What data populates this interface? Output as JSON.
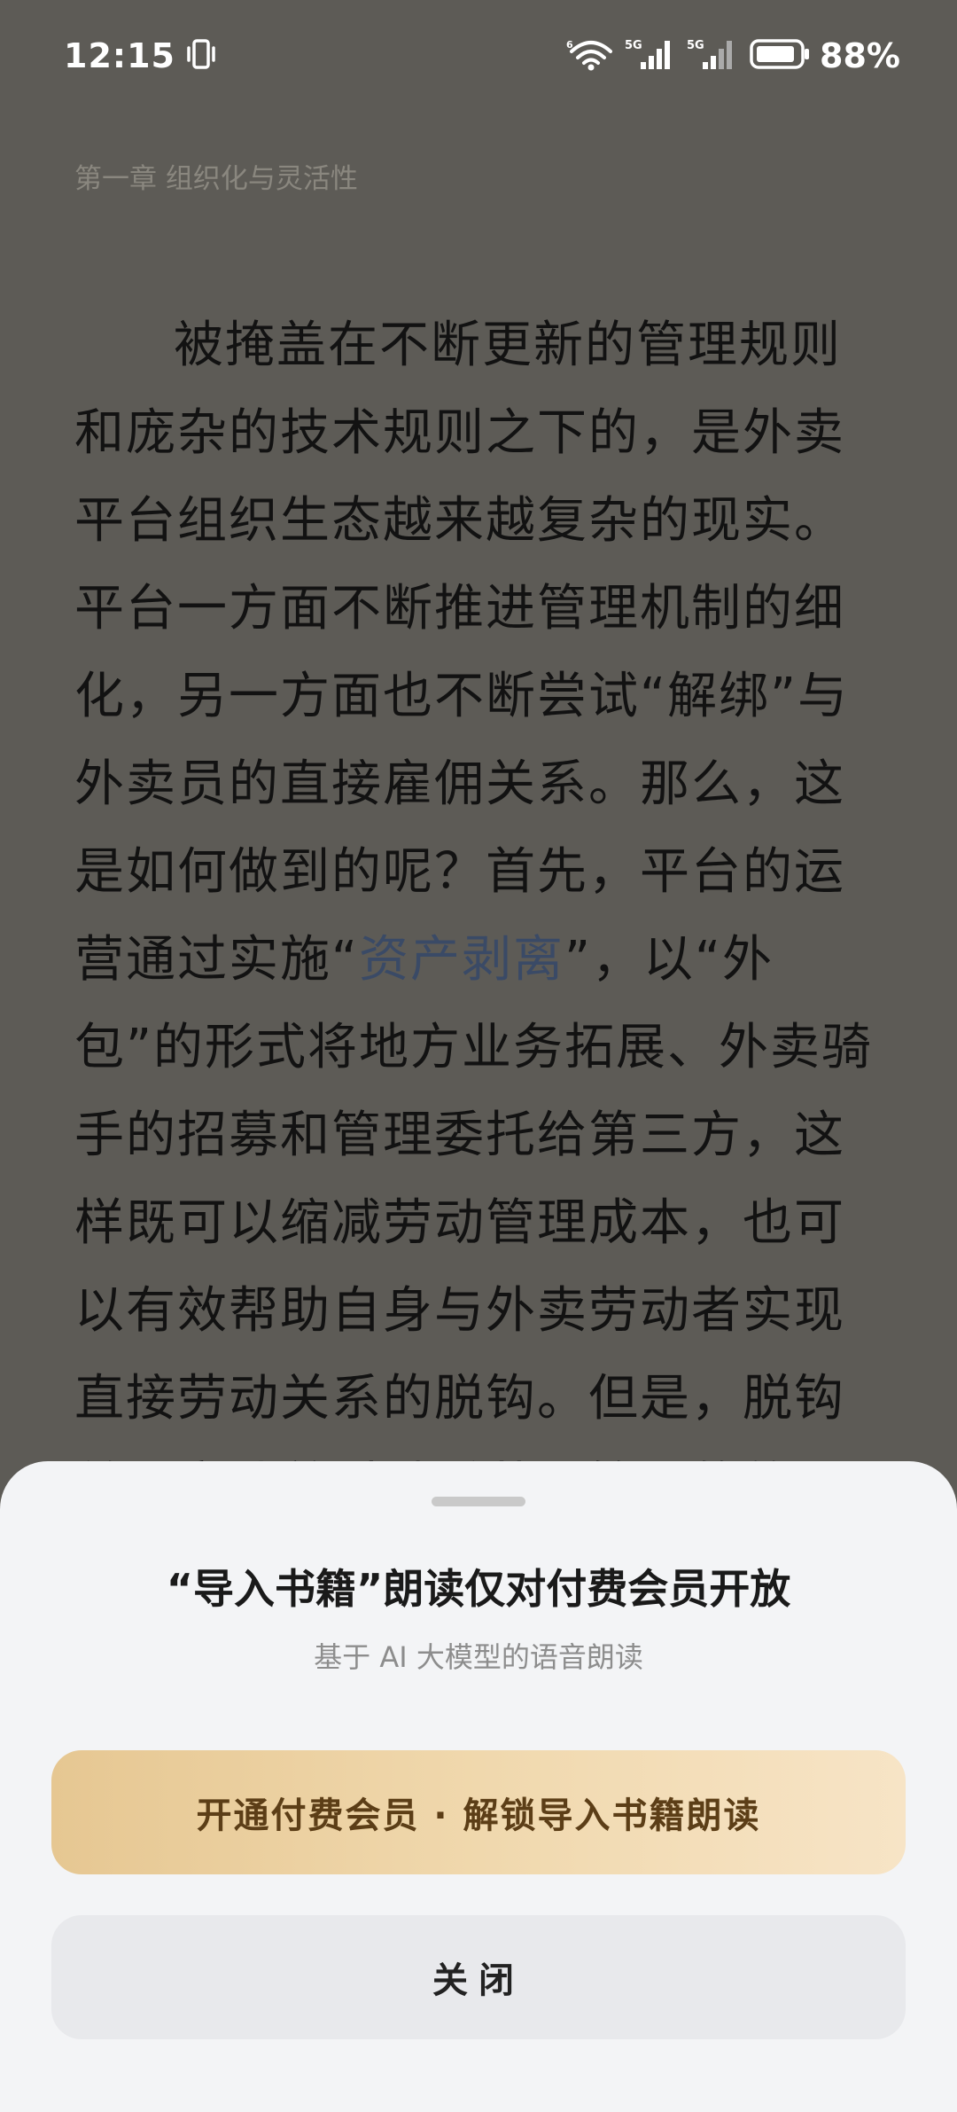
{
  "status_bar": {
    "time": "12:15",
    "battery_percent": "88%",
    "network_labels": [
      "5G",
      "5G"
    ]
  },
  "reader": {
    "chapter_title": "第一章 组织化与灵活性",
    "text_before_highlight": "被掩盖在不断更新的管理规则和庞杂的技术规则之下的，是外卖平台组织生态越来越复杂的现实。平台一方面不断推进管理机制的细化，另一方面也不断尝试“解绑”与外卖员的直接雇佣关系。那么，这是如何做到的呢？首先，平台的运营通过实施“",
    "highlight_text": "资产剥离",
    "text_after_highlight": "”，以“外包”的形式将地方业务拓展、外卖骑手的招募和管理委托给第三方，这样既可以缩减劳动管理成本，也可以有效帮助自身与外卖劳动者实现直接劳动关系的脱钩。但是，脱钩并不意味着对骑手劳动管理的放任。相反，平台通过与劳务公司的合"
  },
  "sheet": {
    "title": "“导入书籍”朗读仅对付费会员开放",
    "subtitle": "基于 AI 大模型的语音朗读",
    "upgrade_button_label": "开通付费会员 · 解锁导入书籍朗读",
    "close_button_label": "关闭"
  },
  "colors": {
    "dim_background": "#5d5b56",
    "sheet_background": "#f3f4f6",
    "upgrade_gradient_start": "#e6c792",
    "upgrade_gradient_end": "#f7e4c6",
    "link_highlight": "#3a4a66"
  },
  "icons": [
    "vibrate-icon",
    "wifi-icon",
    "signal-icon",
    "signal-icon",
    "battery-icon"
  ]
}
